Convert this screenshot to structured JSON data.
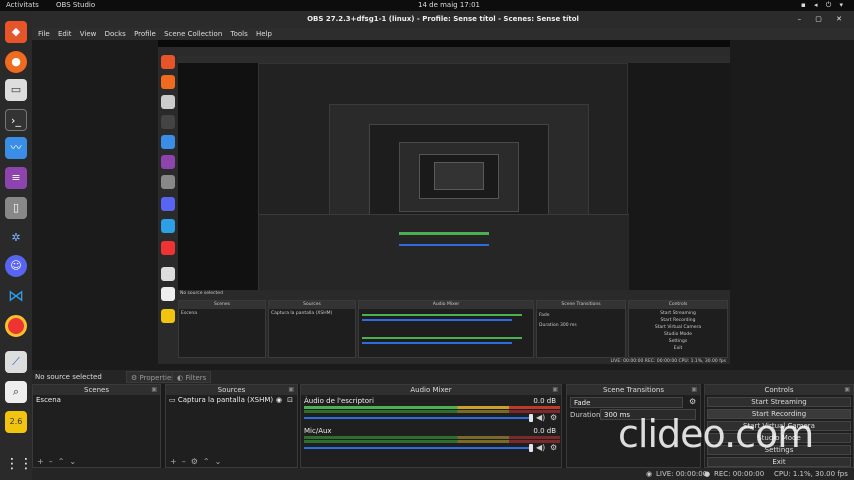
{
  "system": {
    "activities": "Activitats",
    "app_name": "OBS Studio",
    "clock": "14 de maig  17:01"
  },
  "window": {
    "title": "OBS 27.2.3+dfsg1-1 (linux) - Profile: Sense títol - Scenes: Sense títol"
  },
  "menu": [
    "File",
    "Edit",
    "View",
    "Docks",
    "Profile",
    "Scene Collection",
    "Tools",
    "Help"
  ],
  "source_bar": {
    "no_source": "No source selected",
    "properties": "Properties",
    "filters": "Filters"
  },
  "scenes": {
    "title": "Scenes",
    "items": [
      "Escena"
    ]
  },
  "sources": {
    "title": "Sources",
    "items": [
      "Captura la pantalla (XSHM)"
    ]
  },
  "mixer": {
    "title": "Audio Mixer",
    "channels": [
      {
        "name": "Àudio de l'escriptori",
        "db": "0.0 dB"
      },
      {
        "name": "Mic/Aux",
        "db": "0.0 dB"
      }
    ]
  },
  "transitions": {
    "title": "Scene Transitions",
    "selected": "Fade",
    "duration_label": "Duration",
    "duration": "300 ms"
  },
  "controls": {
    "title": "Controls",
    "buttons": [
      "Start Streaming",
      "Start Recording",
      "Start Virtual Camera",
      "Studio Mode",
      "Settings",
      "Exit"
    ]
  },
  "status": {
    "live": "LIVE: 00:00:00",
    "rec": "REC: 00:00:00",
    "cpu": "CPU: 1.1%, 30.00 fps"
  },
  "watermark": "clideo.com",
  "colors": {
    "accent": "#2d6cdf",
    "meter_green": "#4caf50",
    "meter_yellow": "#c9a227",
    "meter_red": "#c0392b"
  }
}
